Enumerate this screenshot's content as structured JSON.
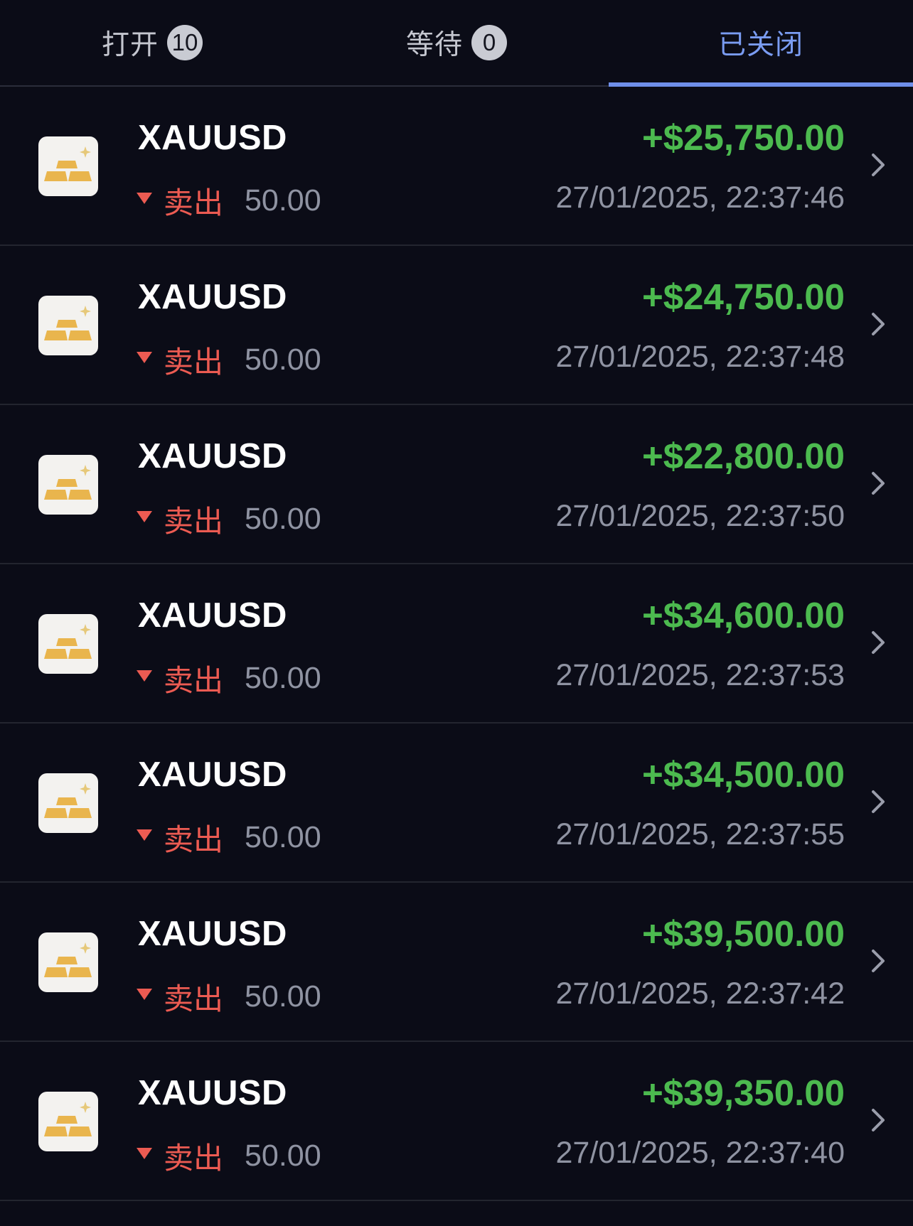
{
  "tabs": [
    {
      "label": "打开",
      "count": "10",
      "active": false
    },
    {
      "label": "等待",
      "count": "0",
      "active": false
    },
    {
      "label": "已关闭",
      "count": null,
      "active": true
    }
  ],
  "colors": {
    "background": "#0b0c17",
    "profit_green": "#4cba4f",
    "sell_red": "#ec5b52",
    "active_tab_blue": "#7a9cf2",
    "muted_text": "#8f93a2"
  },
  "trades": [
    {
      "symbol": "XAUUSD",
      "side": "卖出",
      "volume": "50.00",
      "profit": "+$25,750.00",
      "time": "27/01/2025, 22:37:46",
      "icon": "gold-bars-icon"
    },
    {
      "symbol": "XAUUSD",
      "side": "卖出",
      "volume": "50.00",
      "profit": "+$24,750.00",
      "time": "27/01/2025, 22:37:48",
      "icon": "gold-bars-icon"
    },
    {
      "symbol": "XAUUSD",
      "side": "卖出",
      "volume": "50.00",
      "profit": "+$22,800.00",
      "time": "27/01/2025, 22:37:50",
      "icon": "gold-bars-icon"
    },
    {
      "symbol": "XAUUSD",
      "side": "卖出",
      "volume": "50.00",
      "profit": "+$34,600.00",
      "time": "27/01/2025, 22:37:53",
      "icon": "gold-bars-icon"
    },
    {
      "symbol": "XAUUSD",
      "side": "卖出",
      "volume": "50.00",
      "profit": "+$34,500.00",
      "time": "27/01/2025, 22:37:55",
      "icon": "gold-bars-icon"
    },
    {
      "symbol": "XAUUSD",
      "side": "卖出",
      "volume": "50.00",
      "profit": "+$39,500.00",
      "time": "27/01/2025, 22:37:42",
      "icon": "gold-bars-icon"
    },
    {
      "symbol": "XAUUSD",
      "side": "卖出",
      "volume": "50.00",
      "profit": "+$39,350.00",
      "time": "27/01/2025, 22:37:40",
      "icon": "gold-bars-icon"
    }
  ]
}
